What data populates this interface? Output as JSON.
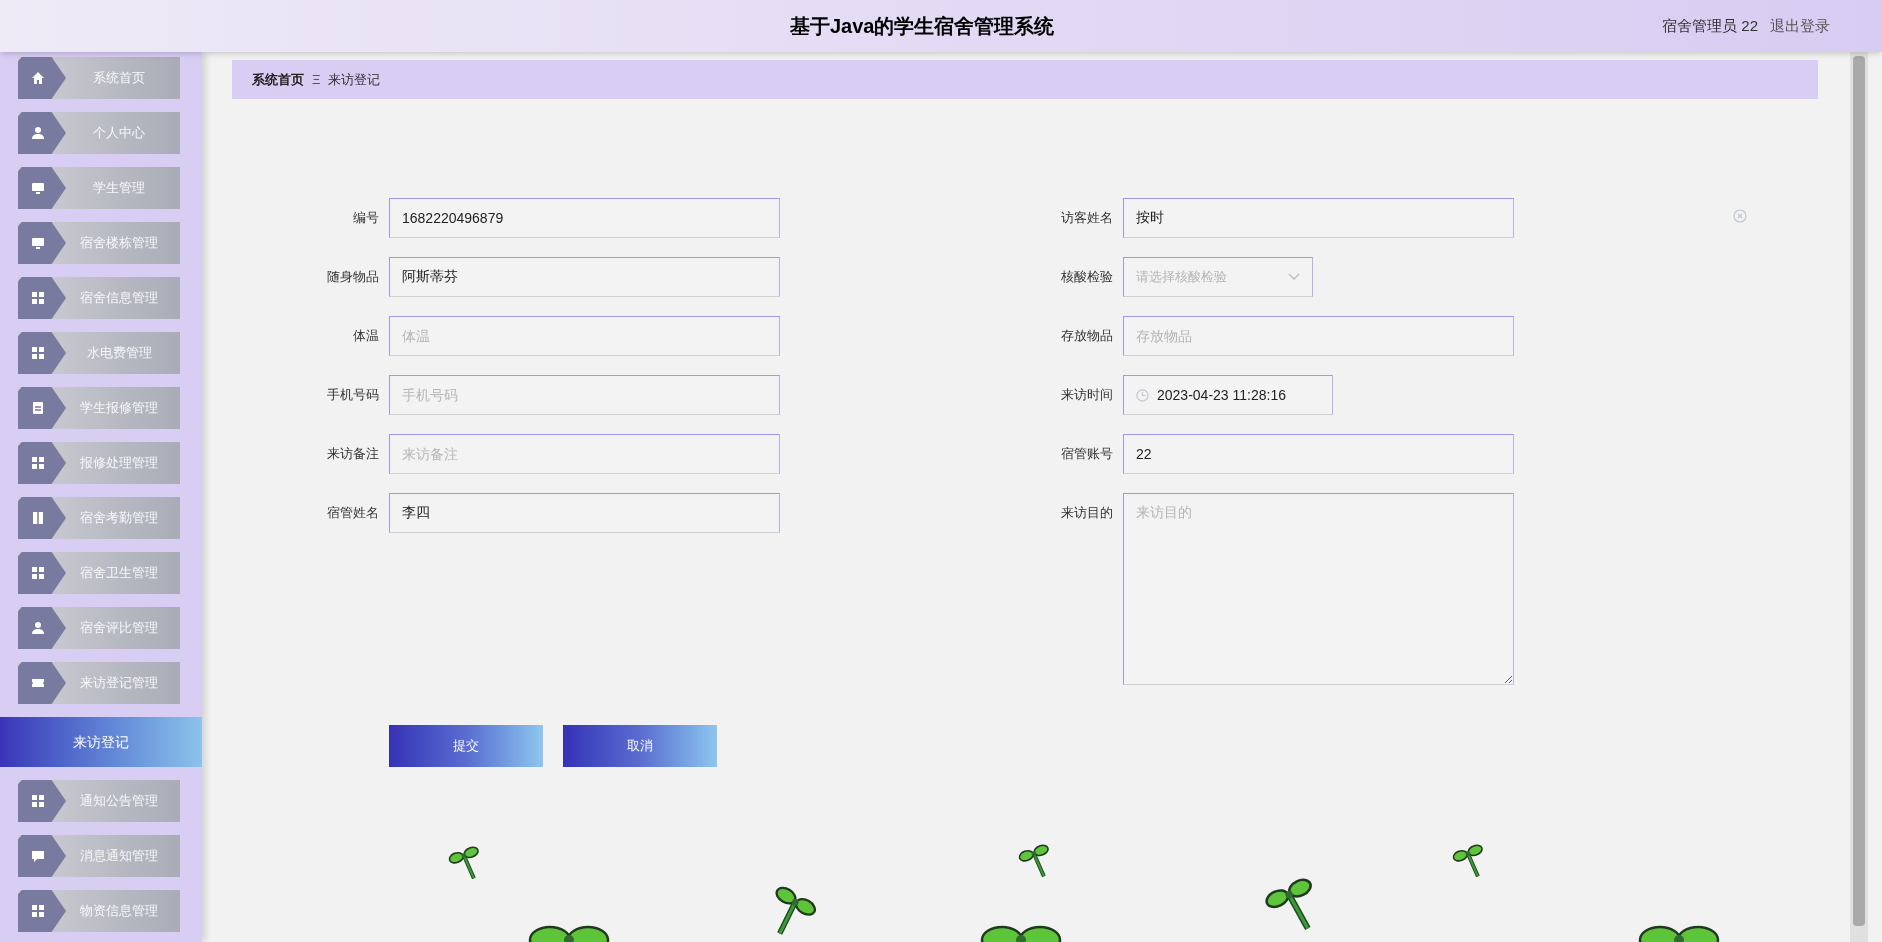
{
  "header": {
    "title": "基于Java的学生宿舍管理系统",
    "user": "宿舍管理员 22",
    "logout": "退出登录"
  },
  "sidebar": {
    "items": [
      {
        "label": "系统首页",
        "kind": "home",
        "selected": false
      },
      {
        "label": "个人中心",
        "kind": "user",
        "selected": false
      },
      {
        "label": "学生管理",
        "kind": "monitor",
        "selected": false
      },
      {
        "label": "宿舍楼栋管理",
        "kind": "monitor",
        "selected": false
      },
      {
        "label": "宿舍信息管理",
        "kind": "grid",
        "selected": false
      },
      {
        "label": "水电费管理",
        "kind": "grid",
        "selected": false
      },
      {
        "label": "学生报修管理",
        "kind": "clipboard",
        "selected": false
      },
      {
        "label": "报修处理管理",
        "kind": "grid",
        "selected": false
      },
      {
        "label": "宿舍考勤管理",
        "kind": "book",
        "selected": false
      },
      {
        "label": "宿舍卫生管理",
        "kind": "grid",
        "selected": false
      },
      {
        "label": "宿舍评比管理",
        "kind": "user",
        "selected": false
      },
      {
        "label": "来访登记管理",
        "kind": "ticket",
        "selected": false
      },
      {
        "label": "来访登记",
        "selected": true
      },
      {
        "label": "通知公告管理",
        "kind": "grid",
        "selected": false
      },
      {
        "label": "消息通知管理",
        "kind": "chat",
        "selected": false
      },
      {
        "label": "物资信息管理",
        "kind": "grid",
        "selected": false
      }
    ]
  },
  "breadcrumb": {
    "items": [
      "系统首页",
      "来访登记"
    ],
    "separator": "Ξ"
  },
  "form": {
    "left": [
      {
        "label": "编号",
        "kind": "text",
        "value": "1682220496879"
      },
      {
        "label": "随身物品",
        "kind": "text",
        "value": "阿斯蒂芬"
      },
      {
        "label": "体温",
        "kind": "text",
        "placeholder": "体温"
      },
      {
        "label": "手机号码",
        "kind": "text",
        "placeholder": "手机号码"
      },
      {
        "label": "来访备注",
        "kind": "text",
        "placeholder": "来访备注"
      },
      {
        "label": "宿管姓名",
        "kind": "text",
        "value": "李四"
      }
    ],
    "right": [
      {
        "label": "访客姓名",
        "kind": "text",
        "value": "按时"
      },
      {
        "label": "核酸检验",
        "kind": "select",
        "placeholder": "请选择核酸检验"
      },
      {
        "label": "存放物品",
        "kind": "text",
        "placeholder": "存放物品"
      },
      {
        "label": "来访时间",
        "kind": "datetime",
        "value": "2023-04-23 11:28:16"
      },
      {
        "label": "宿管账号",
        "kind": "text",
        "value": "22"
      },
      {
        "label": "来访目的",
        "kind": "textarea",
        "placeholder": "来访目的"
      }
    ],
    "buttons": [
      "提交",
      "取消"
    ]
  }
}
